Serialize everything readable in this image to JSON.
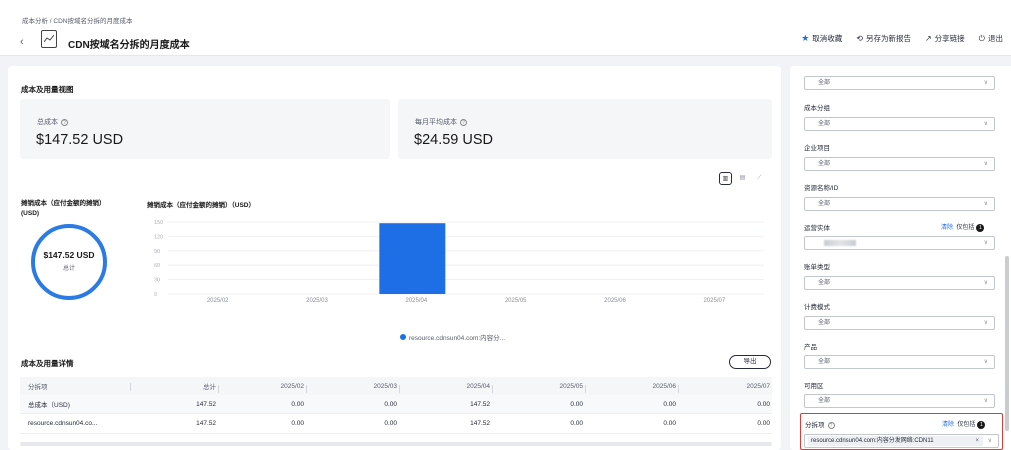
{
  "header": {
    "breadcrumb": "成本分析 / CDN按域名分拆的月度成本",
    "title": "CDN按域名分拆的月度成本",
    "actions": {
      "unfavorite": "取消收藏",
      "save_as": "另存为新报告",
      "share": "分享链接",
      "exit": "退出"
    }
  },
  "overview": {
    "section_title": "成本及用量视图",
    "total_cost_label": "总成本",
    "total_cost_value": "$147.52 USD",
    "avg_cost_label": "每月平均成本",
    "avg_cost_value": "$24.59 USD"
  },
  "donut": {
    "title_line1": "摊销成本（应付金额的摊销）",
    "title_line2": "(USD)",
    "value": "$147.52 USD",
    "sub": "总计"
  },
  "bar_chart_title": "摊销成本（应付金额的摊销）（USD）",
  "chart_data": {
    "type": "bar",
    "categories": [
      "2025/02",
      "2025/03",
      "2025/04",
      "2025/05",
      "2025/06",
      "2025/07"
    ],
    "series": [
      {
        "name": "resource.cdnsun04.com:内容分...",
        "values": [
          0,
          0,
          147.52,
          0,
          0,
          0
        ]
      }
    ],
    "yticks": [
      "0",
      "30",
      "60",
      "90",
      "120",
      "150"
    ],
    "ylim": [
      0,
      150
    ],
    "grid": true,
    "legend": "bottom",
    "color": "#1e6fe6"
  },
  "details": {
    "section_title": "成本及用量详情",
    "export_label": "导出",
    "columns": [
      "分拆项",
      "总计",
      "2025/02",
      "2025/03",
      "2025/04",
      "2025/05",
      "2025/06",
      "2025/07"
    ],
    "rows": [
      [
        "总成本（USD)",
        "147.52",
        "0.00",
        "0.00",
        "147.52",
        "0.00",
        "0.00",
        "0.00"
      ],
      [
        "resource.cdnsun04.co...",
        "147.52",
        "0.00",
        "0.00",
        "147.52",
        "0.00",
        "0.00",
        "0.00"
      ]
    ]
  },
  "filters": {
    "top_select": "全部",
    "cost_group_label": "成本分组",
    "cost_group_value": "全部",
    "enterprise_project_label": "企业项目",
    "enterprise_project_value": "全部",
    "resource_label": "资源名称/ID",
    "resource_value": "全部",
    "entity_label": "运营实体",
    "clear": "清除",
    "include_only": "仅包括",
    "badge": "1",
    "bill_type_label": "账单类型",
    "bill_type_value": "全部",
    "billing_mode_label": "计费模式",
    "billing_mode_value": "全部",
    "product_label": "产品",
    "product_value": "全部",
    "az_label": "可用区",
    "az_value": "全部",
    "split_label": "分拆项",
    "split_tag": "resource.cdnsun04.com:内容分发网络:CDN11"
  },
  "colors": {
    "accent": "#1e6fe6",
    "highlight": "#e53935"
  }
}
